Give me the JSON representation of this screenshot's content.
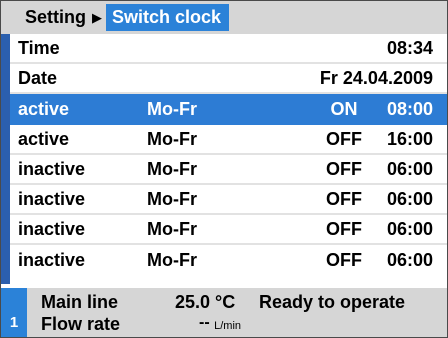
{
  "breadcrumb": {
    "root": "Setting",
    "current": "Switch clock"
  },
  "info_rows": [
    {
      "label": "Time",
      "value": "08:34"
    },
    {
      "label": "Date",
      "value": "Fr 24.04.2009"
    }
  ],
  "schedule_rows": [
    {
      "status": "active",
      "days": "Mo-Fr",
      "state": "ON",
      "time": "08:00",
      "selected": true
    },
    {
      "status": "active",
      "days": "Mo-Fr",
      "state": "OFF",
      "time": "16:00",
      "selected": false
    },
    {
      "status": "inactive",
      "days": "Mo-Fr",
      "state": "OFF",
      "time": "06:00",
      "selected": false
    },
    {
      "status": "inactive",
      "days": "Mo-Fr",
      "state": "OFF",
      "time": "06:00",
      "selected": false
    },
    {
      "status": "inactive",
      "days": "Mo-Fr",
      "state": "OFF",
      "time": "06:00",
      "selected": false
    },
    {
      "status": "inactive",
      "days": "Mo-Fr",
      "state": "OFF",
      "time": "06:00",
      "selected": false
    }
  ],
  "footer": {
    "badge": "1",
    "main_line_label": "Main line",
    "main_line_value": "25.0 °C",
    "flow_rate_label": "Flow rate",
    "flow_rate_value": "--",
    "flow_rate_unit": "L/min",
    "status": "Ready to operate"
  },
  "colors": {
    "accent": "#2b82d8",
    "selected_row": "#2d7cd4",
    "left_bar": "#2b5fae",
    "header_bg": "#d6d6d6"
  }
}
